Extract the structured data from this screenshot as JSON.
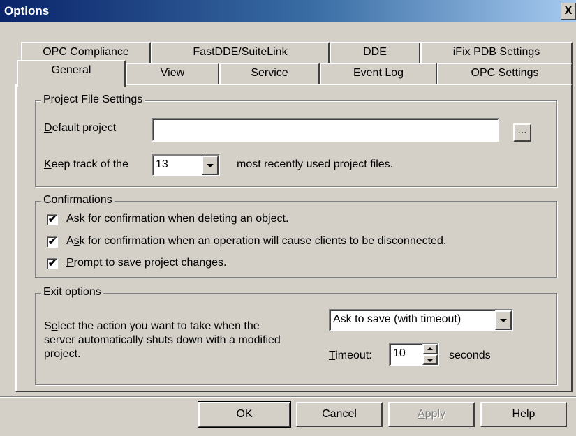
{
  "window": {
    "title": "Options",
    "close_glyph": "X"
  },
  "tabs": {
    "back_row": [
      "OPC Compliance",
      "FastDDE/SuiteLink",
      "DDE",
      "iFix PDB Settings"
    ],
    "front_row": [
      "General",
      "View",
      "Service",
      "Event Log",
      "OPC Settings"
    ],
    "active": "General"
  },
  "project_file_settings": {
    "legend": "Project File Settings",
    "default_project_label_pre": "D",
    "default_project_label_post": "efault project",
    "default_project_value": "",
    "browse_label": "...",
    "keep_track_pre": "K",
    "keep_track_post": "eep track of the",
    "mru_count": "13",
    "mru_suffix": "most recently used project files."
  },
  "confirmations": {
    "legend": "Confirmations",
    "items": [
      {
        "pre": "Ask for ",
        "u": "c",
        "post": "onfirmation when deleting an object.",
        "checked": true
      },
      {
        "pre": "A",
        "u": "s",
        "post": "k for confirmation when an operation will cause clients to be disconnected.",
        "checked": true
      },
      {
        "pre": "",
        "u": "P",
        "post": "rompt to save project changes.",
        "checked": true
      }
    ],
    "check_glyph": "✔"
  },
  "exit_options": {
    "legend": "Exit options",
    "description_line1_pre": "S",
    "description_line1_u": "e",
    "description_line1_post": "lect the action you want to take when the",
    "description_line2": "server automatically shuts down with a modified",
    "description_line3": "project.",
    "action_value": "Ask to save (with timeout)",
    "timeout_label_u": "T",
    "timeout_label_post": "imeout:",
    "timeout_value": "10",
    "timeout_unit": "seconds"
  },
  "buttons": {
    "ok": "OK",
    "cancel": "Cancel",
    "apply_u": "A",
    "apply_post": "pply",
    "help": "Help"
  }
}
